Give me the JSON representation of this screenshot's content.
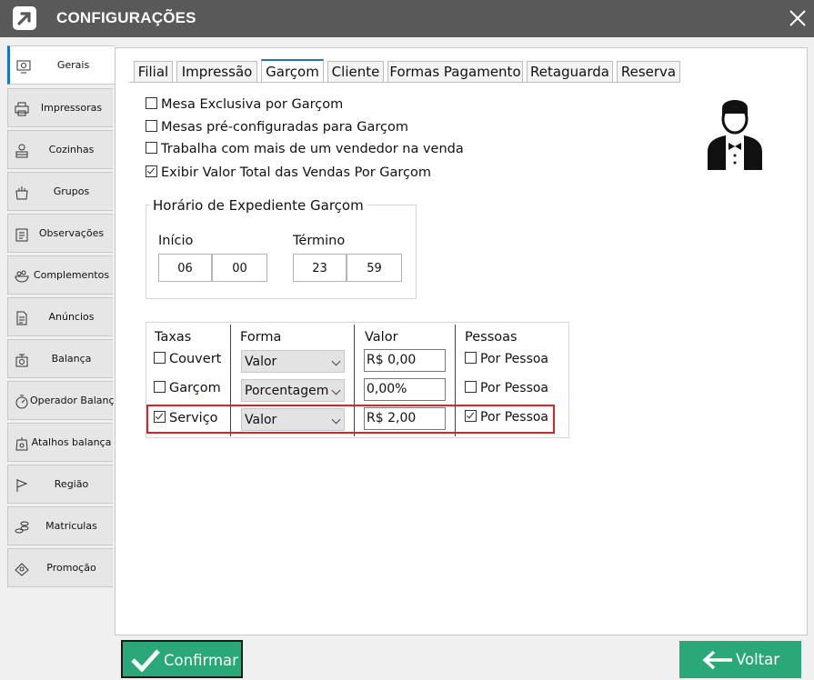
{
  "window": {
    "title": "CONFIGURAÇÕES"
  },
  "sidebar": {
    "items": [
      {
        "label": "Gerais",
        "icon": "monitor-settings-icon",
        "active": true
      },
      {
        "label": "Impressoras",
        "icon": "printer-icon"
      },
      {
        "label": "Cozinhas",
        "icon": "kitchen-icon"
      },
      {
        "label": "Grupos",
        "icon": "grocery-bag-icon"
      },
      {
        "label": "Observações",
        "icon": "clipboard-icon"
      },
      {
        "label": "Complementos",
        "icon": "salad-bowl-icon"
      },
      {
        "label": "Anúncios",
        "icon": "document-icon"
      },
      {
        "label": "Balança",
        "icon": "scale-icon"
      },
      {
        "label": "Operador  Balança",
        "icon": "scale-operator-icon"
      },
      {
        "label": "Atalhos balança",
        "icon": "scale-shortcut-icon"
      },
      {
        "label": "Região",
        "icon": "flag-icon"
      },
      {
        "label": "Matriculas",
        "icon": "coins-icon"
      },
      {
        "label": "Promoção",
        "icon": "promotion-icon"
      }
    ]
  },
  "tabs": [
    {
      "label": "Filial"
    },
    {
      "label": "Impressão"
    },
    {
      "label": "Garçom",
      "active": true
    },
    {
      "label": "Cliente"
    },
    {
      "label": "Formas Pagamento"
    },
    {
      "label": "Retaguarda"
    },
    {
      "label": "Reserva"
    }
  ],
  "options": [
    {
      "label": "Mesa Exclusiva por Garçom",
      "checked": false
    },
    {
      "label": "Mesas pré-configuradas para Garçom",
      "checked": false
    },
    {
      "label": "Trabalha com mais de um vendedor na venda",
      "checked": false
    },
    {
      "label": "Exibir Valor Total das Vendas Por Garçom",
      "checked": true
    }
  ],
  "schedule": {
    "title": "Horário de Expediente Garçom",
    "start_label": "Início",
    "start_hour": "06",
    "start_min": "00",
    "end_label": "Término",
    "end_hour": "23",
    "end_min": "59"
  },
  "fees": {
    "headers": {
      "taxas": "Taxas",
      "forma": "Forma",
      "valor": "Valor",
      "pessoas": "Pessoas"
    },
    "rows": [
      {
        "name": "Couvert",
        "checked": false,
        "forma": "Valor",
        "valor": "R$ 0,00",
        "per_person": "Por Pessoa",
        "per_person_checked": false
      },
      {
        "name": "Garçom",
        "checked": false,
        "forma": "Porcentagem",
        "valor": "0,00%",
        "per_person": "Por Pessoa",
        "per_person_checked": false
      },
      {
        "name": "Serviço",
        "checked": true,
        "forma": "Valor",
        "valor": "R$ 2,00",
        "per_person": "Por Pessoa",
        "per_person_checked": true,
        "highlighted": true
      }
    ]
  },
  "buttons": {
    "confirm": "Confirmar",
    "back": "Voltar"
  },
  "colors": {
    "titlebar": "#595959",
    "accent_green": "#2aa878",
    "highlight_red": "#d8232a",
    "tab_accent": "#1e73be"
  }
}
